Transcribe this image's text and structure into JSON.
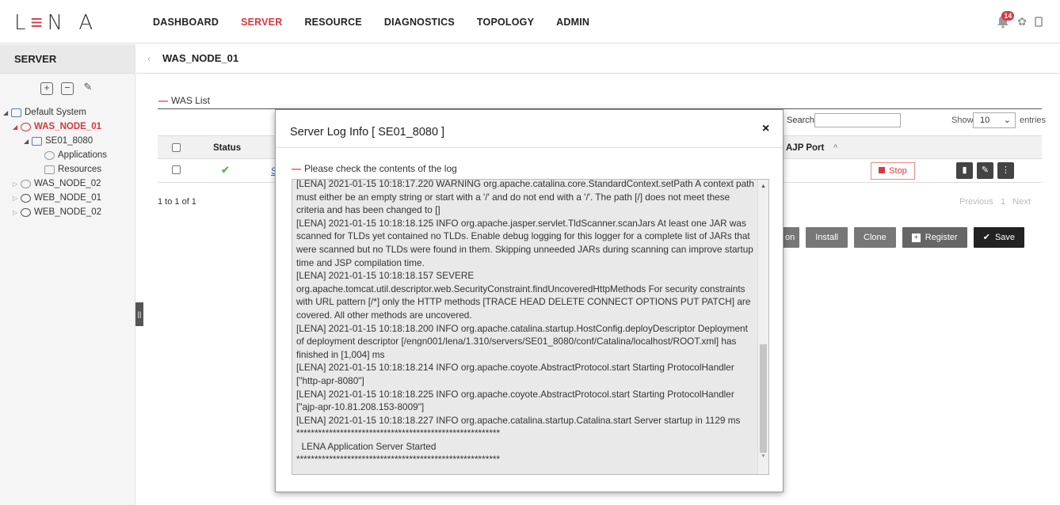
{
  "app": {
    "logo_letters": "L",
    "logo_rest": "N A",
    "notification_count": "14"
  },
  "nav": {
    "items": [
      "DASHBOARD",
      "SERVER",
      "RESOURCE",
      "DIAGNOSTICS",
      "TOPOLOGY",
      "ADMIN"
    ],
    "active": "SERVER"
  },
  "sidebar": {
    "title": "SERVER",
    "tree": [
      {
        "label": "Default System",
        "level": 0
      },
      {
        "label": "WAS_NODE_01",
        "level": 1
      },
      {
        "label": "SE01_8080",
        "level": 2
      },
      {
        "label": "Applications",
        "level": 3
      },
      {
        "label": "Resources",
        "level": 3
      },
      {
        "label": "WAS_NODE_02",
        "level": 1
      },
      {
        "label": "WEB_NODE_01",
        "level": 1
      },
      {
        "label": "WEB_NODE_02",
        "level": 1
      }
    ]
  },
  "main": {
    "title": "WAS_NODE_01",
    "section": "WAS List",
    "search_label": "Search",
    "show_label": "Show",
    "show_value": "10",
    "entries_label": "entries",
    "columns": {
      "status": "Status",
      "ajp_port": "AJP Port"
    },
    "row_link_char": "S",
    "stop_label": "Stop",
    "pager_info": "1 to 1 of 1",
    "pager_prev": "Previous",
    "pager_page": "1",
    "pager_next": "Next",
    "actions": {
      "partial": "on",
      "install": "Install",
      "clone": "Clone",
      "register": "Register",
      "save": "Save"
    }
  },
  "modal": {
    "title": "Server Log Info [ SE01_8080 ]",
    "close": "×",
    "subtitle": "Please check the contents of the log",
    "log_lines": [
      "[LENA] 2021-01-15 10:18:17.220 WARNING org.apache.catalina.core.StandardContext.setPath A context path must either be an empty string or start with a '/' and do not end with a '/'. The path [/] does not meet these criteria and has been changed to []",
      "[LENA] 2021-01-15 10:18:18.125 INFO org.apache.jasper.servlet.TldScanner.scanJars At least one JAR was scanned for TLDs yet contained no TLDs. Enable debug logging for this logger for a complete list of JARs that were scanned but no TLDs were found in them. Skipping unneeded JARs during scanning can improve startup time and JSP compilation time.",
      "[LENA] 2021-01-15 10:18:18.157 SEVERE org.apache.tomcat.util.descriptor.web.SecurityConstraint.findUncoveredHttpMethods For security constraints with URL pattern [/*] only the HTTP methods [TRACE HEAD DELETE CONNECT OPTIONS PUT PATCH] are covered. All other methods are uncovered.",
      "[LENA] 2021-01-15 10:18:18.200 INFO org.apache.catalina.startup.HostConfig.deployDescriptor Deployment of deployment descriptor [/engn001/lena/1.310/servers/SE01_8080/conf/Catalina/localhost/ROOT.xml] has finished in [1,004] ms",
      "[LENA] 2021-01-15 10:18:18.214 INFO org.apache.coyote.AbstractProtocol.start Starting ProtocolHandler [\"http-apr-8080\"]",
      "[LENA] 2021-01-15 10:18:18.225 INFO org.apache.coyote.AbstractProtocol.start Starting ProtocolHandler [\"ajp-apr-10.81.208.153-8009\"]",
      "[LENA] 2021-01-15 10:18:18.227 INFO org.apache.catalina.startup.Catalina.start Server startup in 1129 ms",
      "********************************************************",
      "  LENA Application Server Started",
      "********************************************************"
    ]
  }
}
